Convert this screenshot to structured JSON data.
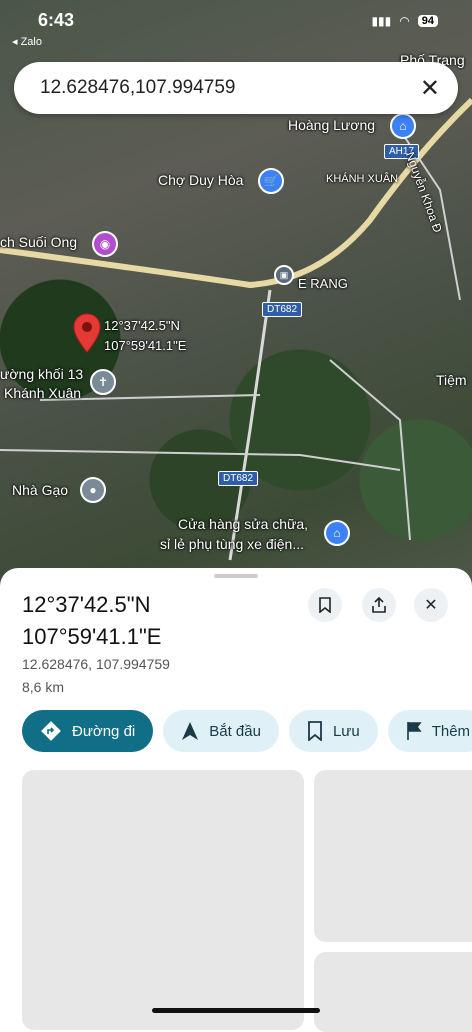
{
  "status": {
    "time": "6:43",
    "back_app": "◂ Zalo",
    "battery": "94"
  },
  "search": {
    "value": "12.628476,107.994759",
    "close_icon": "✕"
  },
  "map_labels": {
    "pho_trang": "Phố Trạng",
    "hoang_luong": "Hoàng Lương",
    "ah17": "AH17",
    "nguyen_khoa": "Nguyễn Khoa Đ",
    "cho_duy_hoa": "Chợ Duy Hòa",
    "khanh_xuan": "KHÁNH XUÂN",
    "suoi_ong": "ch Suối Ong",
    "e_rang": "E RANG",
    "dt682_a": "DT682",
    "coord_label_1": "12°37'42.5\"N",
    "coord_label_2": "107°59'41.1\"E",
    "duong_khoi": "ường khối 13",
    "khanh_xuan_2": "Khánh Xuân",
    "tiem": "Tiệm",
    "dt682_b": "DT682",
    "nha_gao": "Nhà Gạo",
    "cua_hang_1": "Cửa hàng sửa chữa,",
    "cua_hang_2": "sỉ lẻ phụ tùng xe điện..."
  },
  "sheet": {
    "lat_dms": "12°37'42.5\"N",
    "lng_dms": "107°59'41.1\"E",
    "decimal": "12.628476, 107.994759",
    "distance": "8,6 km"
  },
  "actions": [
    {
      "label": "Đường đi",
      "icon": "directions-icon"
    },
    {
      "label": "Bắt đầu",
      "icon": "navigate-icon"
    },
    {
      "label": "Lưu",
      "icon": "bookmark-icon"
    },
    {
      "label": "Thêm",
      "icon": "flag-icon"
    }
  ]
}
